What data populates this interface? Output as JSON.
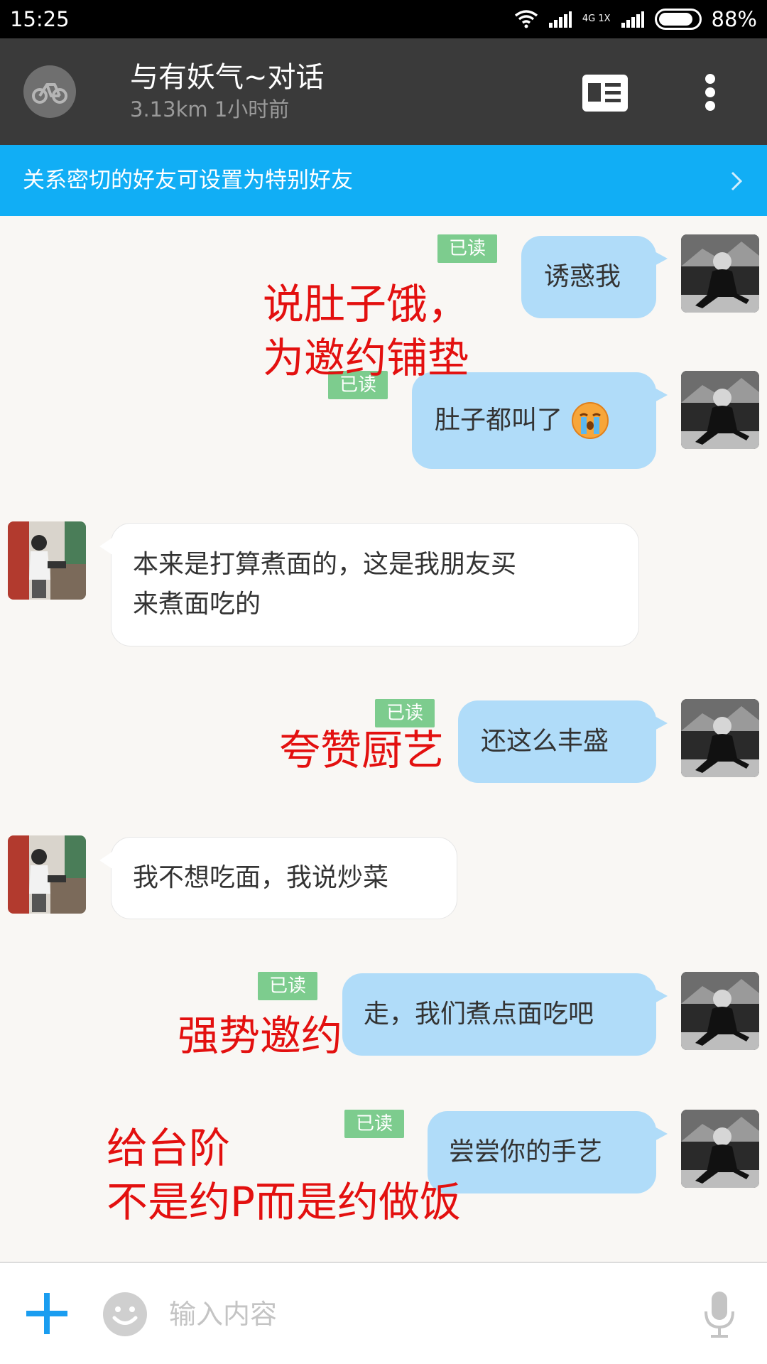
{
  "status_bar": {
    "time": "15:25",
    "network_label": "4G 1X",
    "battery_percent": "88%",
    "battery_level": 0.88
  },
  "header": {
    "title": "与有妖气~对话",
    "subtitle": "3.13km 1小时前",
    "avatar_icon": "bike-icon",
    "card_icon": "profile-card-icon",
    "menu_icon": "more-vertical-icon"
  },
  "banner": {
    "text": "关系密切的好友可设置为特别好友",
    "icon": "chevron-right-icon"
  },
  "messages": [
    {
      "side": "out",
      "text": "诱惑我",
      "read": "已读"
    },
    {
      "side": "out",
      "text": "肚子都叫了",
      "emoji": "crying-face-emoji",
      "read": "已读"
    },
    {
      "side": "in",
      "line1": "本来是打算煮面的，这是我朋友买",
      "line2": "来煮面吃的"
    },
    {
      "side": "out",
      "text": "还这么丰盛",
      "read": "已读"
    },
    {
      "side": "in",
      "text": "我不想吃面，我说炒菜"
    },
    {
      "side": "out",
      "text": "走，我们煮点面吃吧",
      "read": "已读"
    },
    {
      "side": "out",
      "text": "尝尝你的手艺",
      "read": "已读"
    }
  ],
  "annotations": {
    "a1_line1": "说肚子饿，",
    "a1_line2": "为邀约铺垫",
    "a2": "夸赞厨艺",
    "a3": "强势邀约",
    "a4_line1": "给台阶",
    "a4_line2": "不是约P而是约做饭"
  },
  "input_bar": {
    "placeholder": "输入内容",
    "plus_icon": "plus-icon",
    "emoji_icon": "smiley-icon",
    "mic_icon": "microphone-icon"
  },
  "colors": {
    "banner": "#11aef5",
    "outgoing_bubble": "#b0dcf9",
    "read_badge": "#7dcc8e",
    "annotation": "#e3100f",
    "header": "#3a3a3a"
  }
}
